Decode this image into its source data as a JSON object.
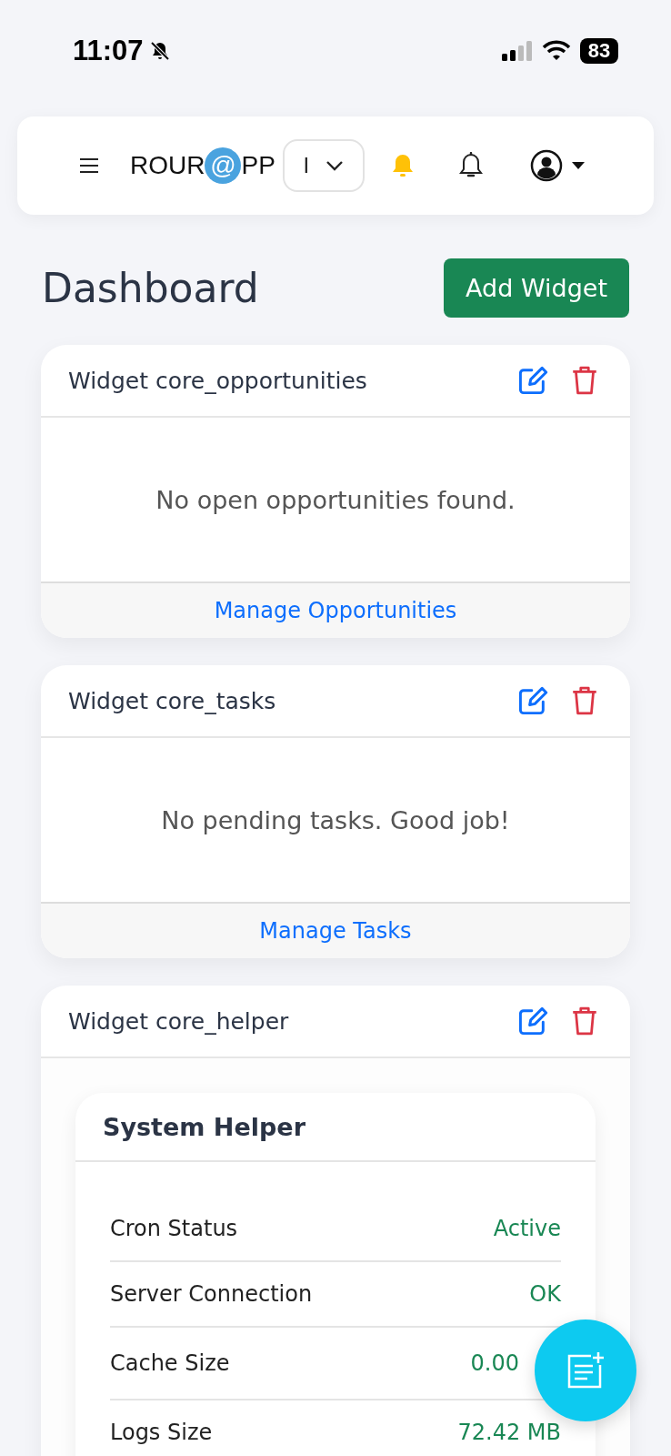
{
  "status_bar": {
    "time": "11:07",
    "battery": "83"
  },
  "navbar": {
    "logo_left": "ROUR",
    "logo_mark": "@",
    "logo_right": "PP",
    "selector": "I"
  },
  "page": {
    "title": "Dashboard",
    "add_button": "Add Widget"
  },
  "widgets": [
    {
      "kind": "message",
      "title": "Widget core_opportunities",
      "message": "No open opportunities found.",
      "footer_link": "Manage Opportunities"
    },
    {
      "kind": "message",
      "title": "Widget core_tasks",
      "message": "No pending tasks. Good job!",
      "footer_link": "Manage Tasks"
    },
    {
      "kind": "helper",
      "title": "Widget core_helper",
      "panel_title": "System Helper",
      "rows": [
        {
          "label": "Cron Status",
          "value": "Active"
        },
        {
          "label": "Server Connection",
          "value": "OK"
        },
        {
          "label": "Cache Size",
          "value": "0.00"
        },
        {
          "label": "Logs Size",
          "value": "72.42 MB"
        }
      ]
    }
  ]
}
